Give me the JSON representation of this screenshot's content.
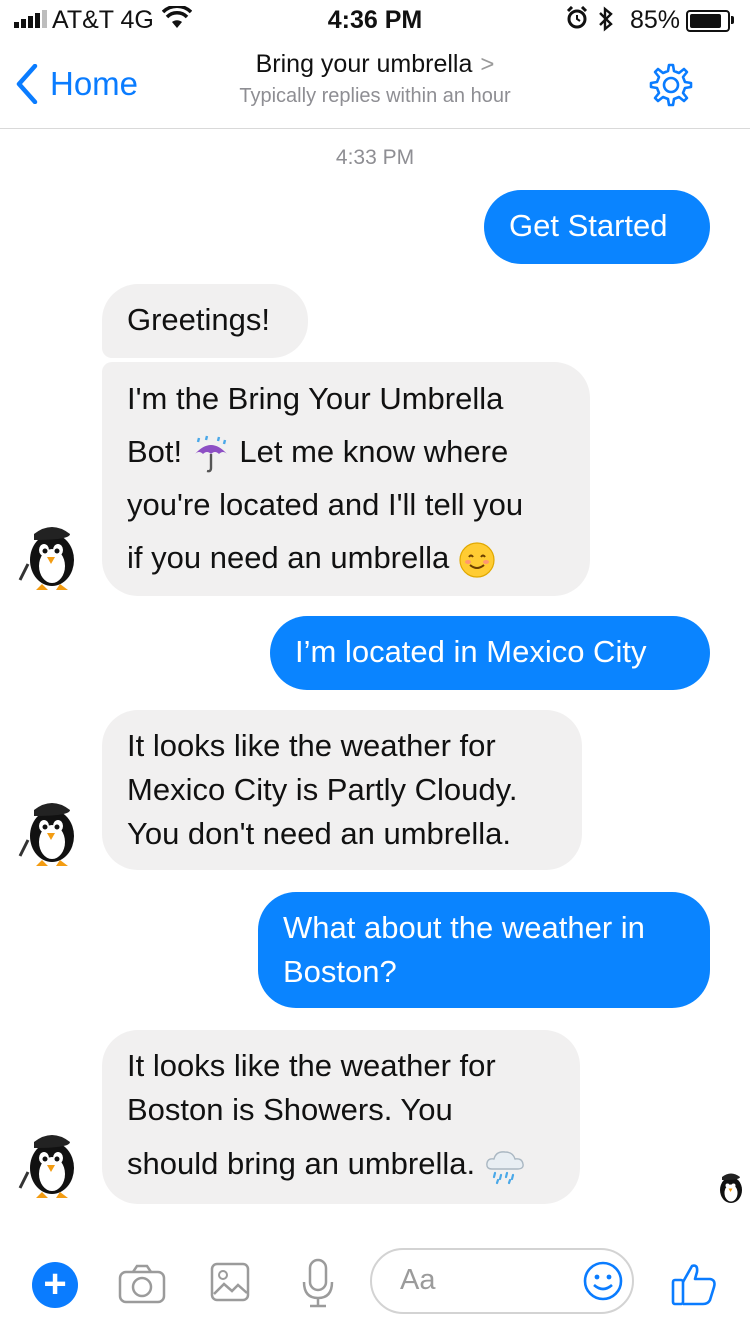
{
  "status_bar": {
    "carrier": "AT&T 4G",
    "time": "4:36 PM",
    "battery_text": "85%",
    "battery_level": 0.85,
    "icons": [
      "signal-icon",
      "wifi-icon",
      "alarm-icon",
      "bluetooth-icon",
      "battery-icon"
    ]
  },
  "header": {
    "back_label": "Home",
    "title": "Bring your umbrella",
    "subtitle": "Typically replies within an hour",
    "settings_icon": "gear-icon"
  },
  "timestamp": "4:33 PM",
  "messages": [
    {
      "sender": "user",
      "text": "Get Started"
    },
    {
      "sender": "bot",
      "text": "Greetings!"
    },
    {
      "sender": "bot",
      "lines": [
        "I'm the Bring Your Umbrella",
        "Bot!",
        "Let me know where",
        "you're located and I'll tell you",
        "if you need an umbrella"
      ],
      "emojis": [
        "umbrella-rain-emoji",
        "smiling-emoji"
      ]
    },
    {
      "sender": "user",
      "text": "I’m located in Mexico City"
    },
    {
      "sender": "bot",
      "lines": [
        "It looks like the weather for",
        "Mexico City is Partly Cloudy.",
        "You don't need an umbrella."
      ]
    },
    {
      "sender": "user",
      "lines": [
        "What about the weather in",
        "Boston?"
      ]
    },
    {
      "sender": "bot",
      "lines": [
        "It looks like the weather for",
        "Boston is Showers. You",
        "should bring an umbrella."
      ],
      "emojis": [
        "rain-cloud-emoji"
      ]
    }
  ],
  "composer": {
    "placeholder": "Aa",
    "icons": [
      "plus-icon",
      "camera-icon",
      "image-icon",
      "microphone-icon",
      "emoji-icon",
      "like-icon"
    ]
  },
  "colors": {
    "accent": "#0a7cff",
    "outgoing_bubble": "#0a84ff",
    "incoming_bubble": "#f1f0f0"
  }
}
